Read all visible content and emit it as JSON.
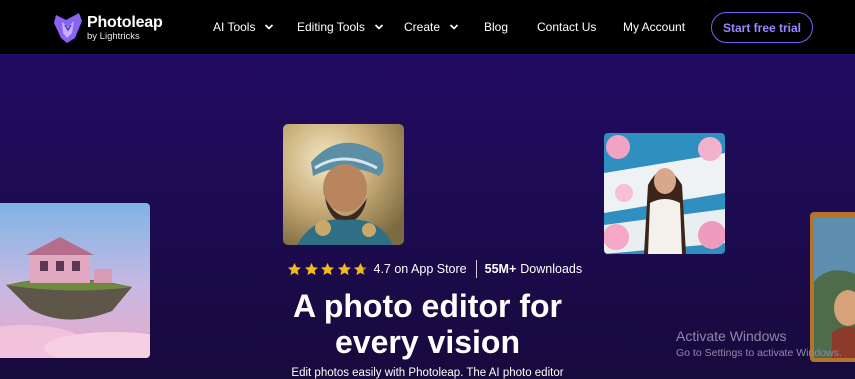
{
  "brand": {
    "name": "Photoleap",
    "sub": "by Lightricks"
  },
  "nav": {
    "items": [
      {
        "label": "AI Tools",
        "dropdown": true
      },
      {
        "label": "Editing Tools",
        "dropdown": true
      },
      {
        "label": "Create",
        "dropdown": true
      },
      {
        "label": "Blog",
        "dropdown": false
      },
      {
        "label": "Contact Us",
        "dropdown": false
      },
      {
        "label": "My Account",
        "dropdown": false
      }
    ],
    "cta": "Start free trial"
  },
  "hero": {
    "rating": {
      "stars": 4.7,
      "max": 5,
      "text": "4.7 on App Store"
    },
    "downloads": {
      "count": "55M+",
      "label": "Downloads"
    },
    "headline_line1": "A photo editor for",
    "headline_line2": "every vision",
    "subline": "Edit photos easily with Photoleap. The AI photo editor"
  },
  "watermark": {
    "title": "Activate Windows",
    "subtitle": "Go to Settings to activate Windows."
  },
  "colors": {
    "nav_bg": "#000000",
    "hero_bg": "#220b63",
    "accent": "#7b5cf6",
    "star": "#f5b81c"
  },
  "icons": {
    "logo": "photoleap-logo-icon",
    "dropdown": "chevron-down-icon",
    "star": "star-icon"
  }
}
